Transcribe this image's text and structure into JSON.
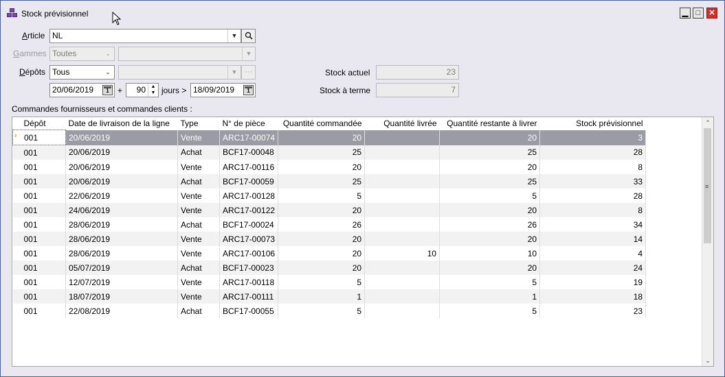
{
  "window": {
    "title": "Stock prévisionnel"
  },
  "form": {
    "article_label_u": "A",
    "article_label_rest": "rticle",
    "article_value": "NL",
    "gammes_label_u": "G",
    "gammes_label_rest": "ammes",
    "gammes_value": "Toutes",
    "depots_label_u": "D",
    "depots_label_rest": "épôts",
    "depots_value": "Tous",
    "date_from": "20/06/2019",
    "plus": "+",
    "days": "90",
    "jours_label": "jours >",
    "date_to": "18/09/2019",
    "stock_actuel_label": "Stock actuel",
    "stock_actuel_value": "23",
    "stock_terme_label": "Stock à terme",
    "stock_terme_value": "7"
  },
  "grid_caption": "Commandes fournisseurs et commandes clients :",
  "columns": [
    "Dépôt",
    "Date de livraison de la ligne",
    "Type",
    "N° de pièce",
    "Quantité commandée",
    "Quantité livrée",
    "Quantité restante à livrer",
    "Stock prévisionnel"
  ],
  "rows": [
    [
      "001",
      "20/06/2019",
      "Vente",
      "ARC17-00074",
      "20",
      "",
      "20",
      "3"
    ],
    [
      "001",
      "20/06/2019",
      "Achat",
      "BCF17-00048",
      "25",
      "",
      "25",
      "28"
    ],
    [
      "001",
      "20/06/2019",
      "Vente",
      "ARC17-00116",
      "20",
      "",
      "20",
      "8"
    ],
    [
      "001",
      "20/06/2019",
      "Achat",
      "BCF17-00059",
      "25",
      "",
      "25",
      "33"
    ],
    [
      "001",
      "22/06/2019",
      "Vente",
      "ARC17-00128",
      "5",
      "",
      "5",
      "28"
    ],
    [
      "001",
      "24/06/2019",
      "Vente",
      "ARC17-00122",
      "20",
      "",
      "20",
      "8"
    ],
    [
      "001",
      "28/06/2019",
      "Achat",
      "BCF17-00024",
      "26",
      "",
      "26",
      "34"
    ],
    [
      "001",
      "28/06/2019",
      "Vente",
      "ARC17-00073",
      "20",
      "",
      "20",
      "14"
    ],
    [
      "001",
      "28/06/2019",
      "Vente",
      "ARC17-00106",
      "20",
      "10",
      "10",
      "4"
    ],
    [
      "001",
      "05/07/2019",
      "Achat",
      "BCF17-00023",
      "20",
      "",
      "20",
      "24"
    ],
    [
      "001",
      "12/07/2019",
      "Vente",
      "ARC17-00118",
      "5",
      "",
      "5",
      "19"
    ],
    [
      "001",
      "18/07/2019",
      "Vente",
      "ARC17-00111",
      "1",
      "",
      "1",
      "18"
    ],
    [
      "001",
      "22/08/2019",
      "Achat",
      "BCF17-00055",
      "5",
      "",
      "5",
      "23"
    ]
  ],
  "icons": {
    "app": "stock-blocks-icon",
    "minimize": "minimize-icon",
    "maximize": "maximize-icon",
    "close": "close-icon",
    "search": "search-icon",
    "dropdown": "chevron-down-icon",
    "calendar": "calendar-icon",
    "ellipsis": "ellipsis-icon"
  }
}
